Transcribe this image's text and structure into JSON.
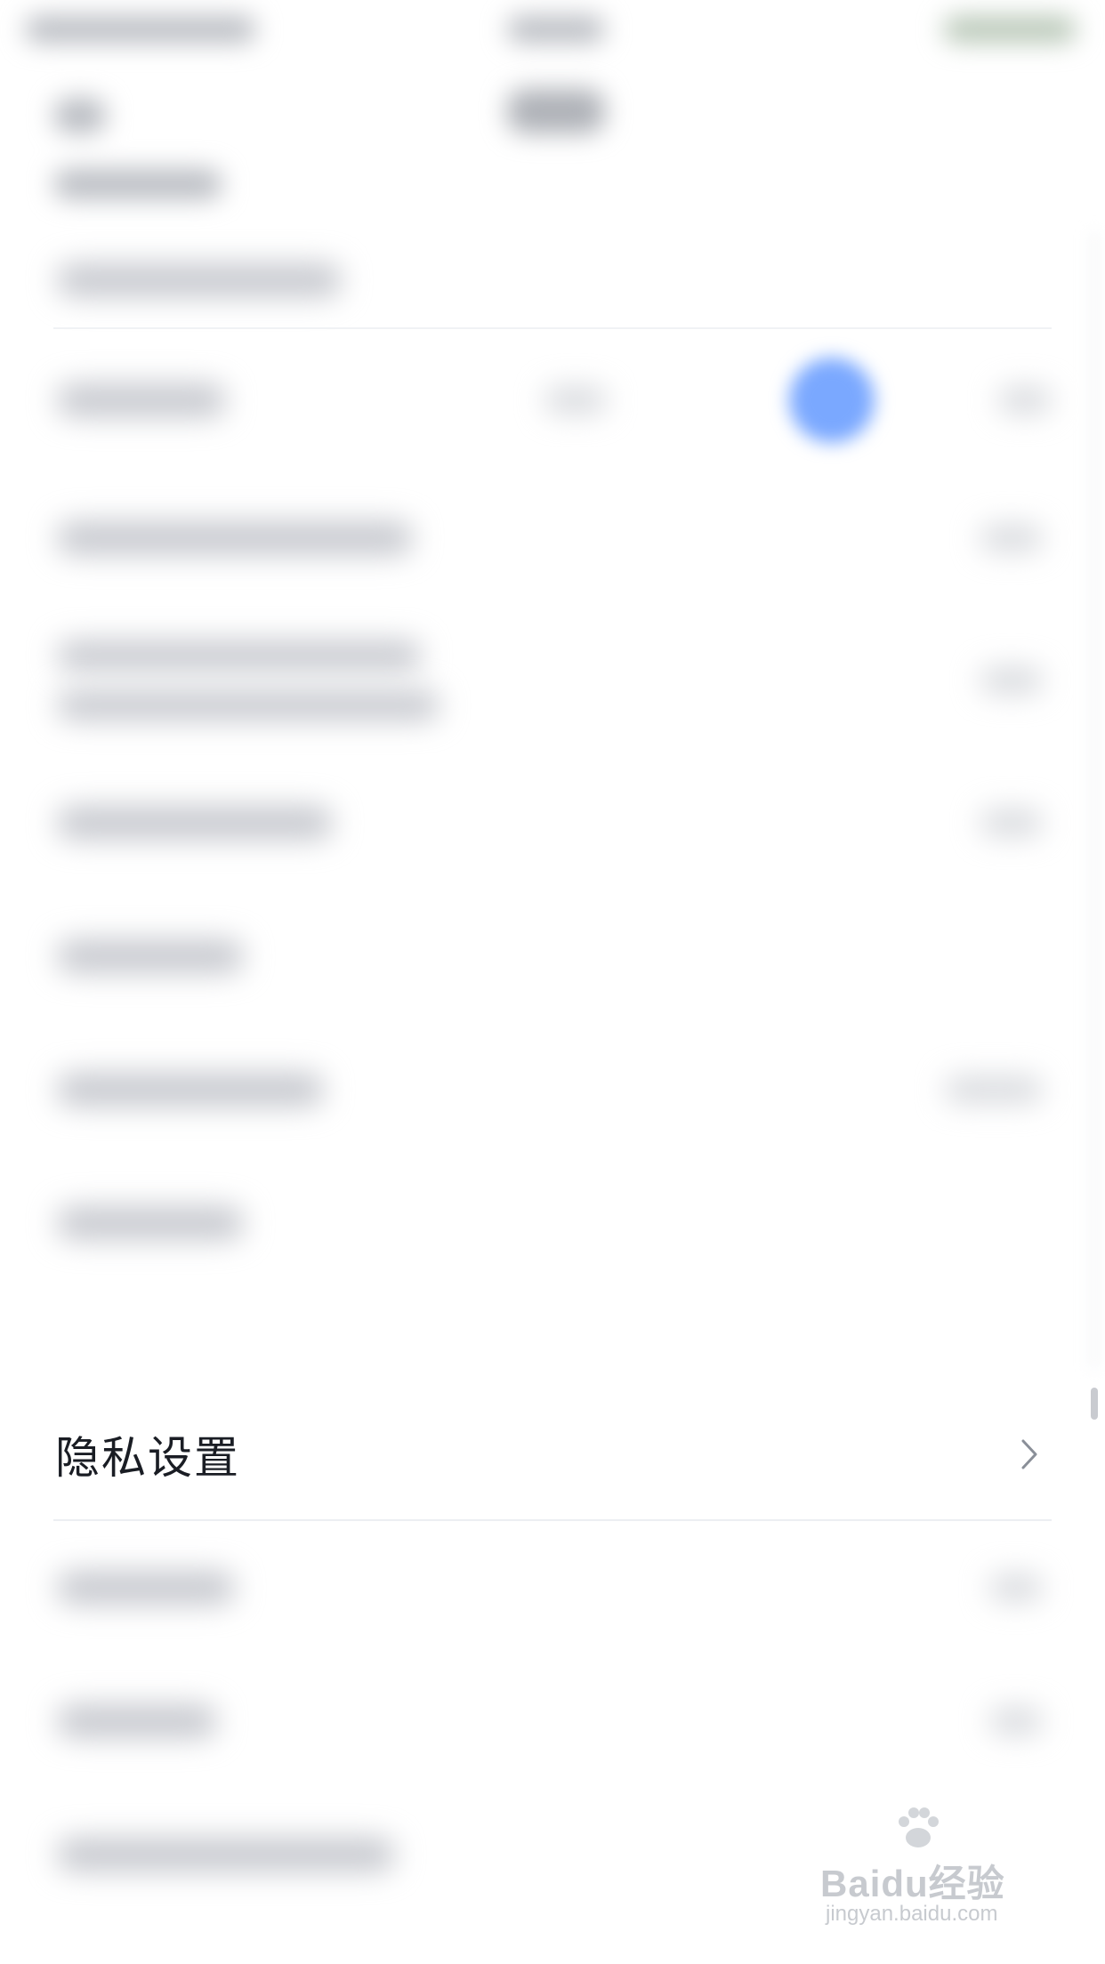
{
  "list": {
    "focused_item": {
      "label": "隐私设置"
    }
  },
  "watermark": {
    "brand": "Baidu经验",
    "domain": "jingyan.baidu.com"
  },
  "colors": {
    "accent_blue": "#7aa8ff",
    "text_primary": "#1a1d24",
    "divider": "#eceef2"
  },
  "icons": {
    "chevron": "chevron-right-icon",
    "paw": "paw-icon"
  }
}
